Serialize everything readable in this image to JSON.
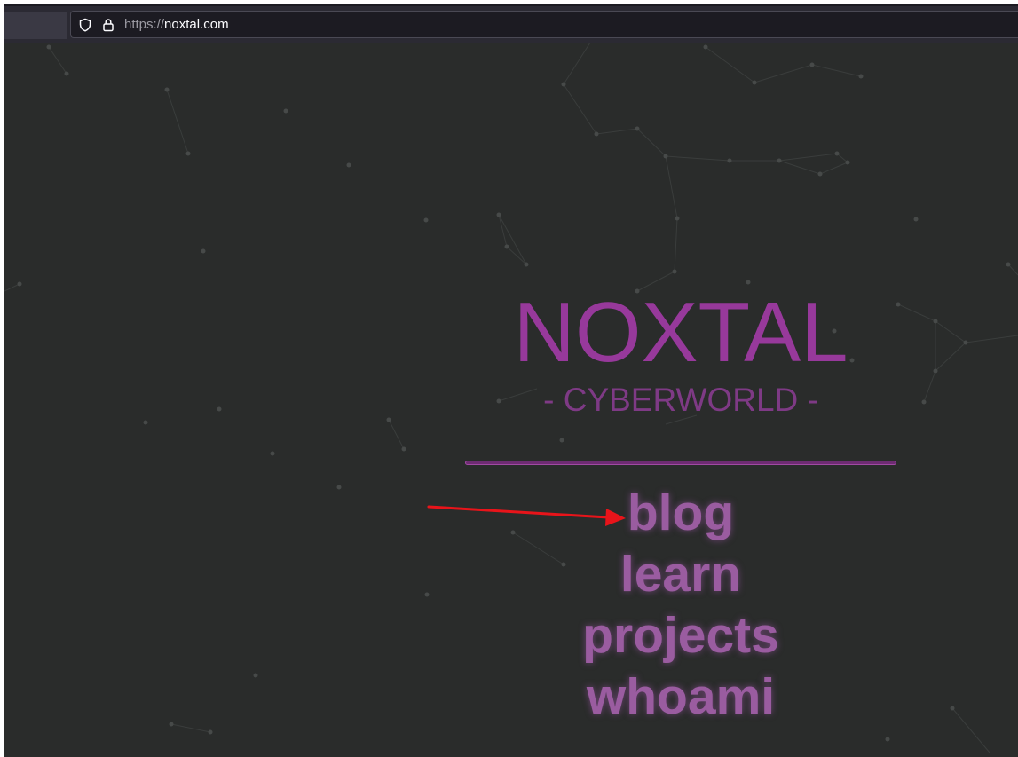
{
  "browser": {
    "url_scheme": "https://",
    "url_host": "noxtal.com",
    "icons": [
      "shield-icon",
      "lock-icon"
    ]
  },
  "site": {
    "title": "NOXTAL",
    "subtitle": "- CYBERWORLD -",
    "nav": [
      {
        "label": "blog"
      },
      {
        "label": "learn"
      },
      {
        "label": "projects"
      },
      {
        "label": "whoami"
      }
    ]
  },
  "theme": {
    "background": "#2a2c2b",
    "accent": "#97399b",
    "link": "#9a5ca0",
    "annotation": "#e8141a"
  },
  "annotation": {
    "type": "red-arrow",
    "points_to": "blog"
  }
}
